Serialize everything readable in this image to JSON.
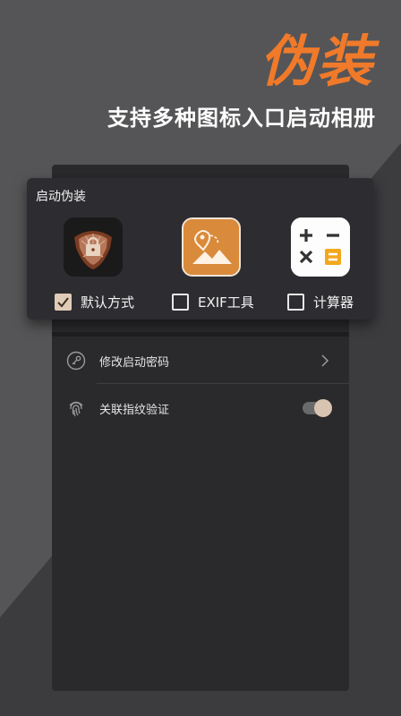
{
  "hero": {
    "title": "伪装",
    "subtitle": "支持多种图标入口启动相册"
  },
  "popup": {
    "title": "启动伪装",
    "options": [
      {
        "label": "默认方式",
        "checked": true
      },
      {
        "label": "EXIF工具",
        "checked": false
      },
      {
        "label": "计算器",
        "checked": false
      }
    ]
  },
  "settings": {
    "change_password": "修改启动密码",
    "fingerprint": "关联指纹验证",
    "fingerprint_enabled": true
  },
  "colors": {
    "accent": "#f07a2a",
    "checkbox": "#e0ccb6",
    "exif_icon": "#d98a3a"
  }
}
